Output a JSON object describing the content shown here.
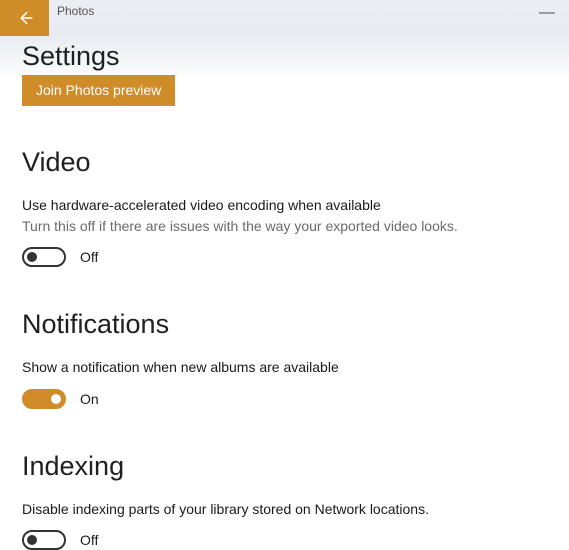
{
  "header": {
    "app_title": "Photos"
  },
  "page_title": "Settings",
  "preview_button": "Join Photos preview",
  "video": {
    "heading": "Video",
    "option_label": "Use hardware-accelerated video encoding when available",
    "option_desc": "Turn this off if there are issues with the way your exported video looks.",
    "toggle_state": "Off",
    "toggle_on": false
  },
  "notifications": {
    "heading": "Notifications",
    "option_label": "Show a notification when new albums are available",
    "toggle_state": "On",
    "toggle_on": true
  },
  "indexing": {
    "heading": "Indexing",
    "option_label": "Disable indexing parts of your library stored on Network locations.",
    "toggle_state": "Off",
    "toggle_on": false
  }
}
